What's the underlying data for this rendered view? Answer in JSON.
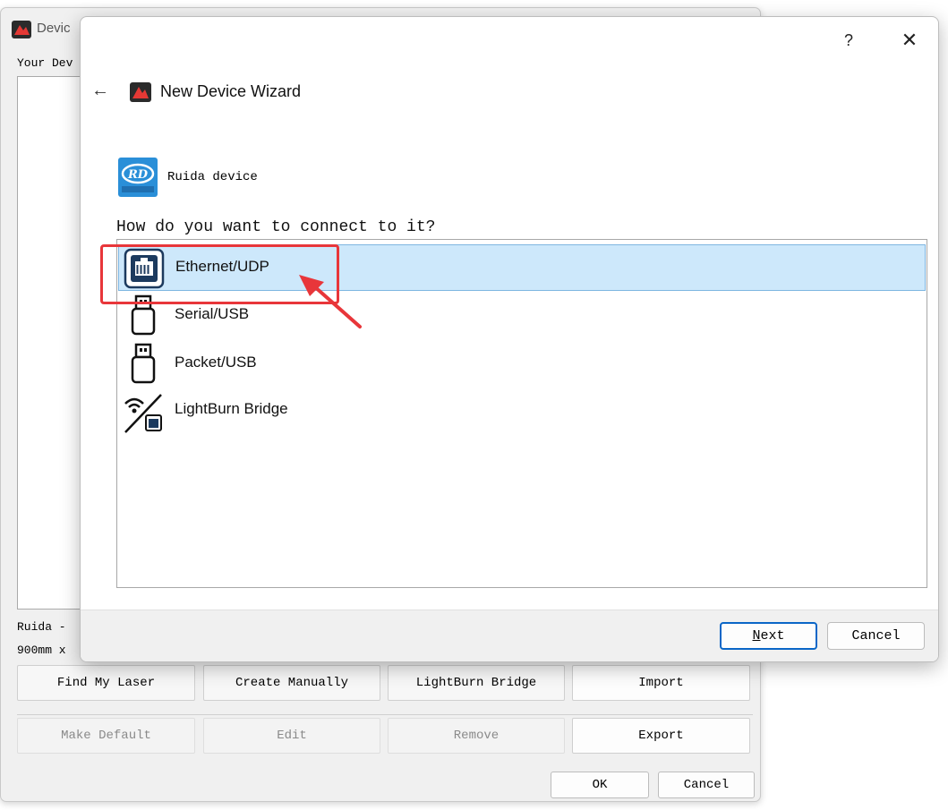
{
  "background_window": {
    "title": "Devic",
    "devices_label": "Your Dev",
    "selected_device_name": "Ruida -",
    "selected_device_size": "900mm x",
    "buttons_row1": [
      "Find My Laser",
      "Create Manually",
      "LightBurn Bridge",
      "Import"
    ],
    "buttons_row2": [
      "Make Default",
      "Edit",
      "Remove",
      "Export"
    ],
    "ok_label": "OK",
    "cancel_label": "Cancel"
  },
  "wizard": {
    "help_glyph": "?",
    "close_glyph": "✕",
    "back_glyph": "←",
    "title": "New Device Wizard",
    "device_type": "Ruida device",
    "question": "How do you want to connect to it?",
    "options": [
      {
        "label": "Ethernet/UDP",
        "icon": "ethernet-port-icon",
        "selected": true
      },
      {
        "label": "Serial/USB",
        "icon": "usb-plug-icon",
        "selected": false
      },
      {
        "label": "Packet/USB",
        "icon": "usb-plug-icon",
        "selected": false
      },
      {
        "label": "LightBurn Bridge",
        "icon": "wifi-bridge-icon",
        "selected": false
      }
    ],
    "next_label": "Next",
    "cancel_label": "Cancel"
  },
  "colors": {
    "selection_bg": "#cde8fb",
    "highlight_red": "#e8363a",
    "default_button_border": "#0a66c7",
    "icon_blue": "#1c3a5e"
  }
}
